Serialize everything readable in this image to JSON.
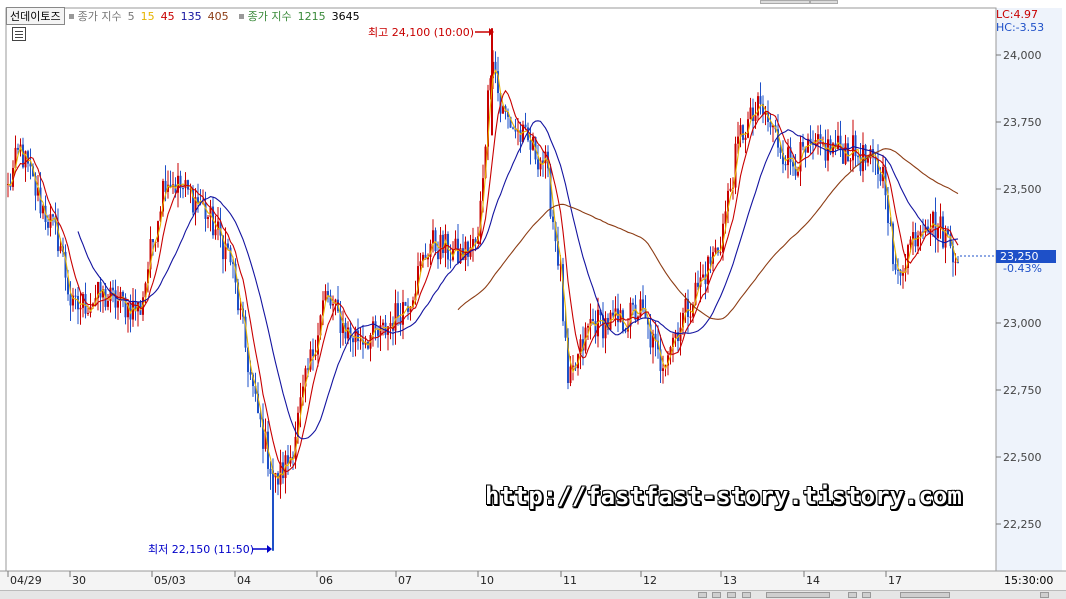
{
  "legend": {
    "name": "선데이토즈",
    "label1": "종가 지수",
    "p5": "5",
    "p15": "15",
    "p45": "45",
    "p135": "135",
    "p405": "405",
    "label2": "종가 지수",
    "p1215": "1215",
    "p3645": "3645"
  },
  "right_panel": {
    "lc": "LC:4.97",
    "hc": "HC:-3.53",
    "current_price": "23,250",
    "change_pct": "-0.43%",
    "time": "15:30:00"
  },
  "annotations": {
    "high": "최고 24,100 (10:00)",
    "low": "최저 22,150 (11:50)"
  },
  "watermark": "http://fastfast-story.tistory.com",
  "colors": {
    "up": "#c80000",
    "down": "#1e50c8",
    "ma5": "#e6b400",
    "ma15": "#c80000",
    "ma45": "#1414a0",
    "ma135": "#8c3c14",
    "axis": "#777777",
    "high_marker": "#c80000",
    "low_marker": "#0000c8"
  },
  "chart_data": {
    "type": "candlestick",
    "title": "선데이토즈",
    "ylim": [
      22150,
      24150
    ],
    "y_ticks": [
      {
        "value": 24000,
        "label": "24,000"
      },
      {
        "value": 23750,
        "label": "23,750"
      },
      {
        "value": 23500,
        "label": "23,500"
      },
      {
        "value": 23250,
        "label": "23,250"
      },
      {
        "value": 23000,
        "label": "23,000"
      },
      {
        "value": 22750,
        "label": "22,750"
      },
      {
        "value": 22500,
        "label": "22,500"
      },
      {
        "value": 22250,
        "label": "22,250"
      }
    ],
    "x_ticks": [
      "04/29",
      "30",
      "05/03",
      "04",
      "06",
      "07",
      "10",
      "11",
      "12",
      "13",
      "14",
      "17"
    ],
    "high": 24100,
    "low": 22150,
    "last": 23250,
    "session_closes": [
      23400,
      23100,
      23500,
      22450,
      23100,
      22950,
      23700,
      22800,
      22850,
      23600,
      23650,
      23250
    ],
    "series": [
      {
        "name": "5"
      },
      {
        "name": "15"
      },
      {
        "name": "45"
      },
      {
        "name": "135"
      }
    ]
  }
}
